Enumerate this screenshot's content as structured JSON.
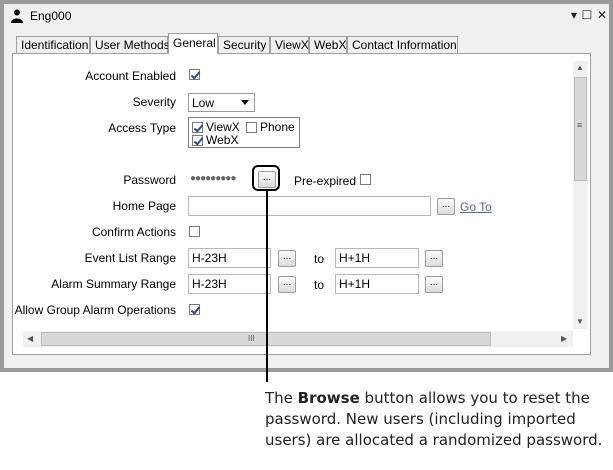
{
  "window": {
    "title": "Eng000",
    "minimize_glyph": "▾",
    "maximize_glyph": "☐",
    "close_glyph": "✕"
  },
  "tabs": [
    {
      "label": "Identification"
    },
    {
      "label": "User Methods"
    },
    {
      "label": "General"
    },
    {
      "label": "Security"
    },
    {
      "label": "ViewX"
    },
    {
      "label": "WebX"
    },
    {
      "label": "Contact Information"
    }
  ],
  "form": {
    "account_enabled": {
      "label": "Account Enabled",
      "checked": true
    },
    "severity": {
      "label": "Severity",
      "value": "Low"
    },
    "access_type": {
      "label": "Access Type",
      "options": [
        {
          "label": "ViewX",
          "checked": true
        },
        {
          "label": "Phone",
          "checked": false
        },
        {
          "label": "WebX",
          "checked": true
        }
      ]
    },
    "password": {
      "label": "Password",
      "value": "●●●●●●●●●",
      "browse_label": "..."
    },
    "pre_expired": {
      "label": "Pre-expired",
      "checked": false
    },
    "home_page": {
      "label": "Home Page",
      "value": "",
      "browse_label": "...",
      "goto_label": "Go To"
    },
    "confirm_actions": {
      "label": "Confirm Actions",
      "checked": false
    },
    "event_list_range": {
      "label": "Event List Range",
      "from": "H-23H",
      "to_label": "to",
      "to": "H+1H",
      "browse_label": "..."
    },
    "alarm_summary_range": {
      "label": "Alarm Summary Range",
      "from": "H-23H",
      "to_label": "to",
      "to": "H+1H",
      "browse_label": "..."
    },
    "allow_group_alarm": {
      "label": "Allow Group Alarm Operations",
      "checked": true
    }
  },
  "scrollbars": {
    "up": "▲",
    "down": "▼",
    "left": "◀",
    "right": "▶",
    "grip_v": "≡",
    "grip_h": "III"
  },
  "callout": {
    "bold": "Browse",
    "text": "The Browse button allows you to reset the password. New users (including imported users) are allocated a randomized password.",
    "prefix": "The ",
    "suffix": " button allows you to reset the password. New users (including imported users) are allocated a randomized password."
  }
}
